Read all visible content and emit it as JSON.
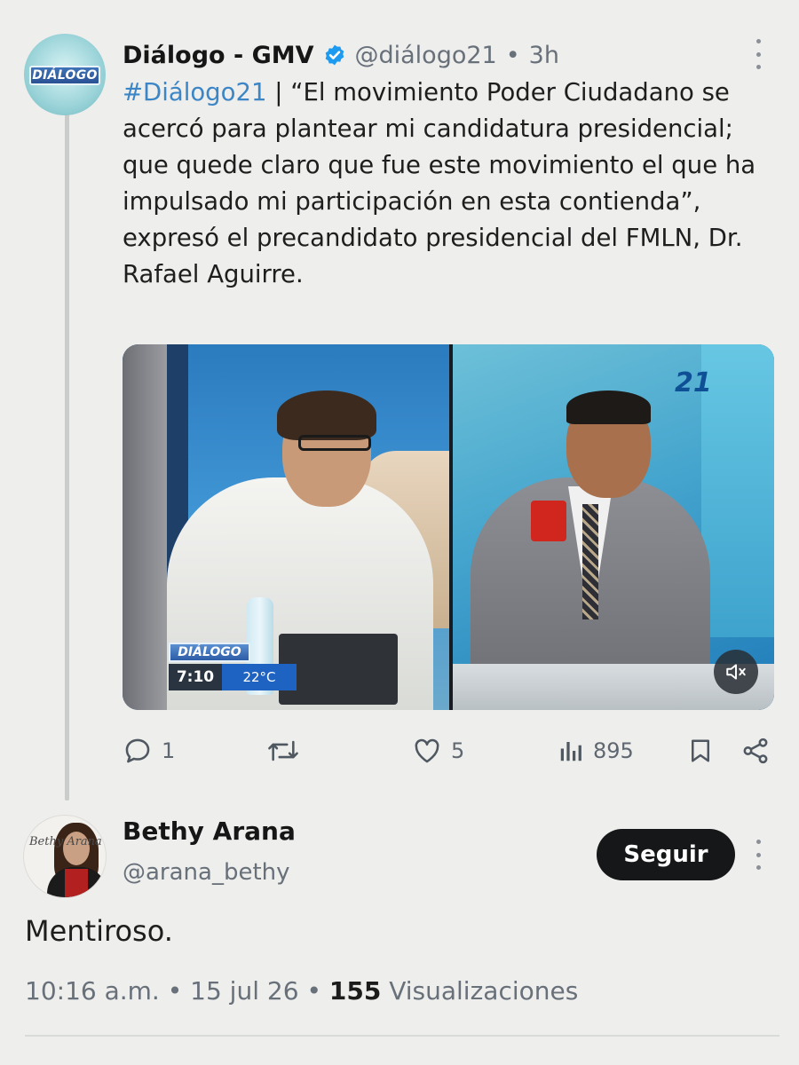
{
  "tweet": {
    "author_name": "Diálogo - GMV",
    "handle": "@diálogo21",
    "separator": "•",
    "time": "3h",
    "hashtag": "#Diálogo21",
    "body": " | “El movimiento Poder Ciudadano se acercó para plantear mi candidatura presidencial; que quede claro que fue este movimiento el que ha impulsado mi participación en esta contienda”, expresó el precandidato presidencial del FMLN, Dr. Rafael Aguirre.",
    "avatar_logo": "DIÁLOGO",
    "verified_color": "#1d9bf0",
    "hashtag_color": "#3d86c6",
    "media": {
      "overlay_logo": "DIÁLOGO",
      "overlay_time": "7:10",
      "overlay_temp": "22°C",
      "channel_logo": "21"
    },
    "actions": {
      "replies": "1",
      "retweets": "",
      "likes": "5",
      "views": "895"
    },
    "icons": [
      "verified-badge-icon",
      "more-icon",
      "mute-icon",
      "reply-icon",
      "retweet-icon",
      "like-icon",
      "views-icon",
      "bookmark-icon",
      "share-icon"
    ]
  },
  "reply": {
    "author_name": "Bethy Arana",
    "handle": "@arana_bethy",
    "follow_label": "Seguir",
    "avatar_signature": "Bethy Arana",
    "text": "Mentiroso.",
    "meta": {
      "time": "10:16 a.m.",
      "sep1": "•",
      "date": "15 jul 26",
      "sep2": "•",
      "views_count": "155",
      "views_label": "Visualizaciones"
    }
  }
}
